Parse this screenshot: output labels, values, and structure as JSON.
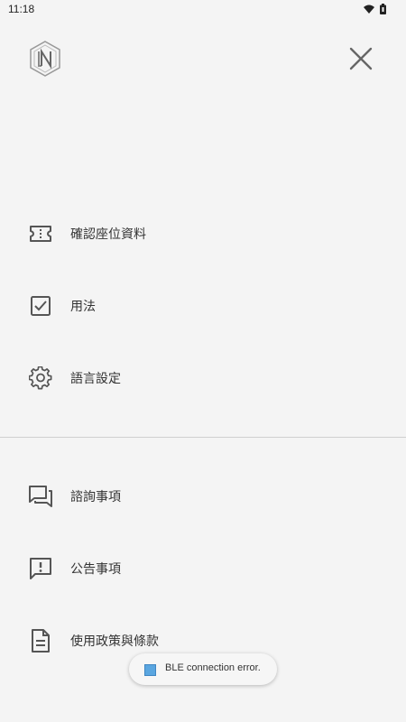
{
  "status_bar": {
    "time": "11:18",
    "icons": [
      "wifi-icon",
      "battery-icon"
    ]
  },
  "header": {
    "logo_icon": "logo-icon",
    "close_icon": "close-icon"
  },
  "menu": {
    "items": [
      {
        "label": "確認座位資料",
        "icon": "ticket-icon"
      },
      {
        "label": "用法",
        "icon": "checkbox-icon"
      },
      {
        "label": "語言設定",
        "icon": "gear-icon"
      }
    ],
    "items2": [
      {
        "label": "諮詢事項",
        "icon": "chat-icon"
      },
      {
        "label": "公告事項",
        "icon": "announcement-icon"
      },
      {
        "label": "使用政策與條款",
        "icon": "document-icon"
      }
    ]
  },
  "toast": {
    "text": "BLE connection error."
  }
}
